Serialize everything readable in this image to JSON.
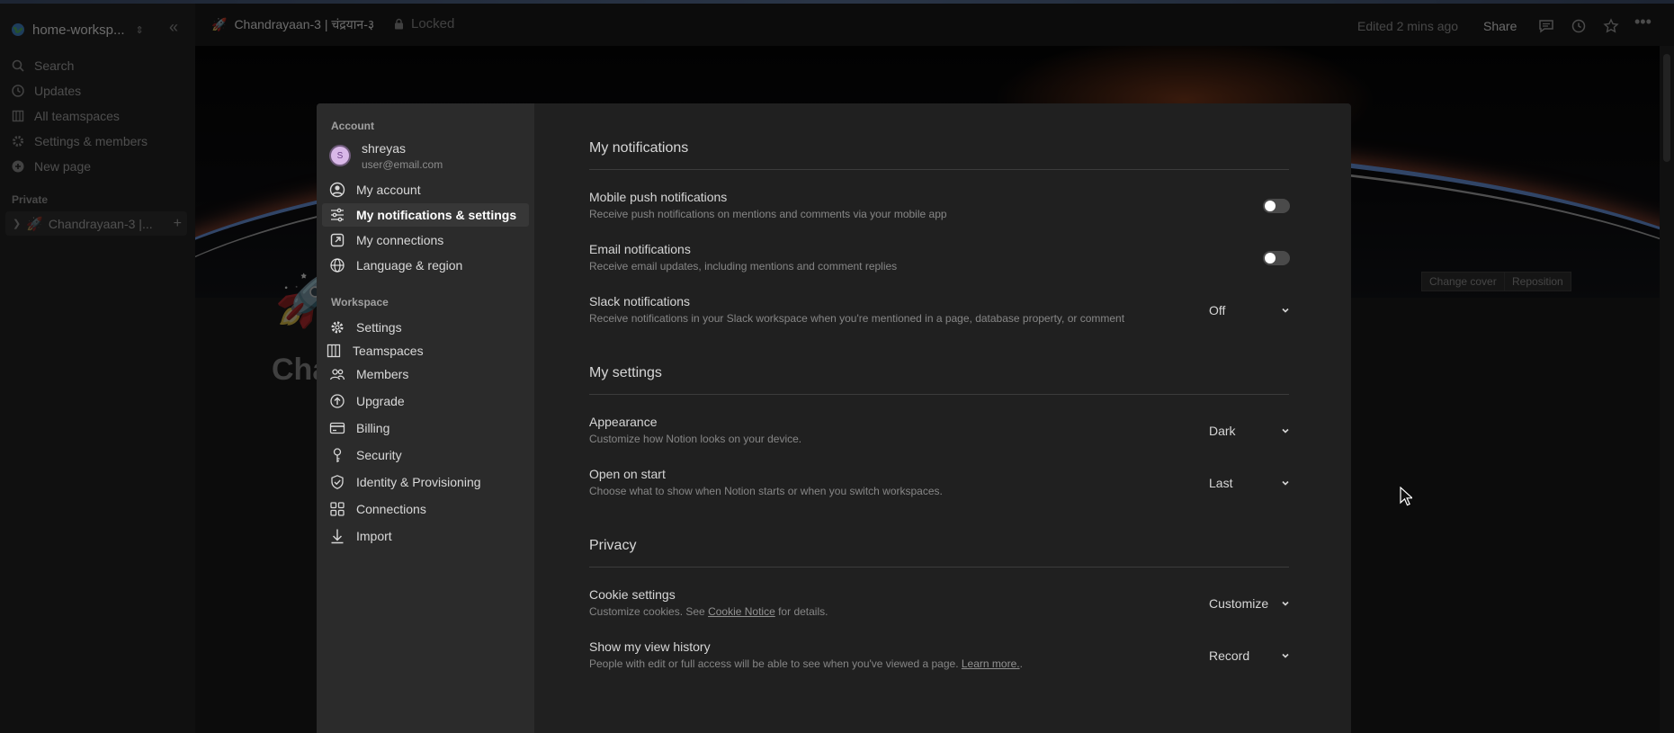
{
  "workspace": {
    "name": "home-worksp...",
    "icon": "globe-icon"
  },
  "sidebar": {
    "items": [
      {
        "label": "Search",
        "icon": "search-icon"
      },
      {
        "label": "Updates",
        "icon": "clock-icon"
      },
      {
        "label": "All teamspaces",
        "icon": "building-icon"
      },
      {
        "label": "Settings & members",
        "icon": "gear-icon"
      },
      {
        "label": "New page",
        "icon": "plus-circle-icon"
      }
    ],
    "section_private": "Private",
    "page": "Chandrayaan-3 |..."
  },
  "topbar": {
    "page_title": "Chandrayaan-3 | चंद्रयान-३",
    "locked": "Locked",
    "edited": "Edited 2 mins ago",
    "share": "Share"
  },
  "cover": {
    "change_cover": "Change cover",
    "reposition": "Reposition",
    "page_heading": "Cha"
  },
  "modal": {
    "nav": {
      "account_header": "Account",
      "user": {
        "name": "shreyas",
        "email": "user@email.com",
        "initial": "S"
      },
      "account_items": [
        {
          "label": "My account",
          "icon": "user-circle-icon"
        },
        {
          "label": "My notifications & settings",
          "icon": "sliders-icon",
          "active": true
        },
        {
          "label": "My connections",
          "icon": "external-link-icon"
        },
        {
          "label": "Language & region",
          "icon": "globe-icon"
        }
      ],
      "workspace_header": "Workspace",
      "workspace_items": [
        {
          "label": "Settings",
          "icon": "gear-icon"
        },
        {
          "label": "Teamspaces",
          "icon": "building-icon"
        },
        {
          "label": "Members",
          "icon": "members-icon"
        },
        {
          "label": "Upgrade",
          "icon": "upgrade-icon"
        },
        {
          "label": "Billing",
          "icon": "credit-card-icon"
        },
        {
          "label": "Security",
          "icon": "key-icon"
        },
        {
          "label": "Identity & Provisioning",
          "icon": "shield-check-icon"
        },
        {
          "label": "Connections",
          "icon": "grid-icon"
        },
        {
          "label": "Import",
          "icon": "download-icon"
        }
      ]
    },
    "notifications": {
      "title": "My notifications",
      "mobile_push": {
        "title": "Mobile push notifications",
        "desc": "Receive push notifications on mentions and comments via your mobile app",
        "enabled": false
      },
      "email": {
        "title": "Email notifications",
        "desc": "Receive email updates, including mentions and comment replies",
        "enabled": false
      },
      "slack": {
        "title": "Slack notifications",
        "desc": "Receive notifications in your Slack workspace when you're mentioned in a page, database property, or comment",
        "value": "Off"
      }
    },
    "settings": {
      "title": "My settings",
      "appearance": {
        "title": "Appearance",
        "desc": "Customize how Notion looks on your device.",
        "value": "Dark"
      },
      "open_on_start": {
        "title": "Open on start",
        "desc": "Choose what to show when Notion starts or when you switch workspaces.",
        "value": "Last"
      }
    },
    "privacy": {
      "title": "Privacy",
      "cookie": {
        "title": "Cookie settings",
        "desc_before": "Customize cookies. See ",
        "desc_link": "Cookie Notice",
        "desc_after": " for details.",
        "value": "Customize"
      },
      "view_history": {
        "title": "Show my view history",
        "desc_before": "People with edit or full access will be able to see when you've viewed a page. ",
        "desc_link": "Learn more.",
        "desc_after": ".",
        "value": "Record"
      }
    }
  }
}
